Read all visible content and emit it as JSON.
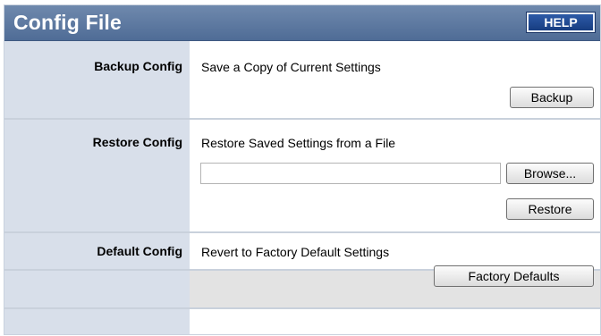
{
  "header": {
    "title": "Config File",
    "help_label": "HELP"
  },
  "sections": [
    {
      "label": "Backup Config",
      "description": "Save a Copy of Current Settings",
      "button": "Backup"
    },
    {
      "label": "Restore Config",
      "description": "Restore Saved Settings from a File",
      "file_value": "",
      "browse_button": "Browse...",
      "button": "Restore"
    },
    {
      "label": "Default Config",
      "description": "Revert to Factory Default Settings",
      "button": "Factory Defaults"
    }
  ]
}
